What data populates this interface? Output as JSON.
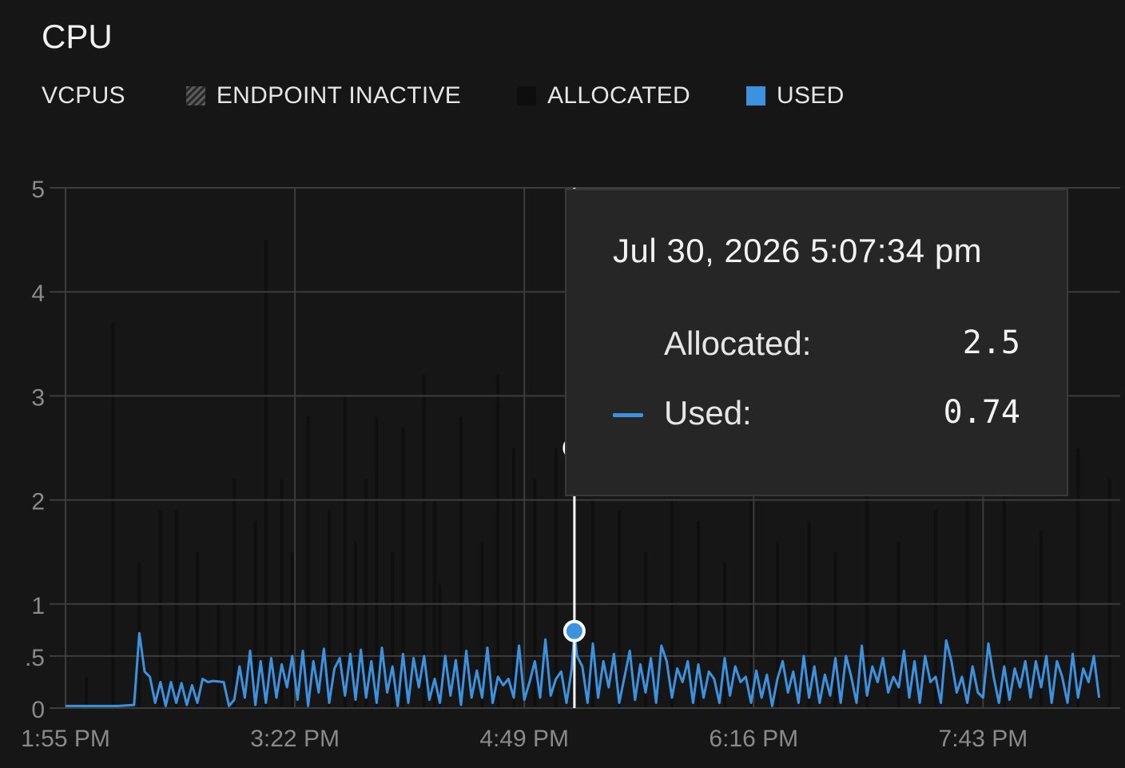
{
  "panel": {
    "title": "CPU"
  },
  "legend": {
    "unit_label": "VCPUS",
    "items": [
      {
        "label": "ENDPOINT INACTIVE",
        "icon": "hatched-square-icon",
        "color": "#5a5a5a"
      },
      {
        "label": "ALLOCATED",
        "icon": "square-icon",
        "color": "#0e0e0e"
      },
      {
        "label": "USED",
        "icon": "square-icon",
        "color": "#3d92e0"
      }
    ]
  },
  "tooltip": {
    "timestamp": "Jul 30, 2026 5:07:34 pm",
    "allocated_label": "Allocated:",
    "allocated_value": "2.5",
    "used_label": "Used:",
    "used_value": "0.74"
  },
  "chart_data": {
    "type": "line",
    "xlim_minutes": [
      0,
      400
    ],
    "x_ticks": [
      {
        "label": "1:55 PM",
        "t": 0
      },
      {
        "label": "3:22 PM",
        "t": 87
      },
      {
        "label": "4:49 PM",
        "t": 174
      },
      {
        "label": "6:16 PM",
        "t": 261
      },
      {
        "label": "7:43 PM",
        "t": 348
      }
    ],
    "y_ticks": [
      {
        "label": "0",
        "v": 0
      },
      {
        "label": ".5",
        "v": 0.5
      },
      {
        "label": "1",
        "v": 1
      },
      {
        "label": "2",
        "v": 2
      },
      {
        "label": "3",
        "v": 3
      },
      {
        "label": "4",
        "v": 4
      },
      {
        "label": "5",
        "v": 5
      }
    ],
    "ylim": [
      0,
      5
    ],
    "grid": true,
    "colors": {
      "used": "#3d92e0",
      "allocated": "#0e0e0e",
      "grid": "#3c3c3c",
      "cursor": "#ffffff"
    },
    "cursor": {
      "t": 193,
      "allocated": 2.5,
      "used": 0.74
    },
    "series": [
      {
        "name": "Used",
        "t": [
          0,
          10,
          20,
          26,
          28,
          30,
          32,
          34,
          36,
          38,
          40,
          42,
          44,
          46,
          48,
          50,
          52,
          54,
          56,
          60,
          62,
          64,
          66,
          68,
          70,
          72,
          74,
          76,
          78,
          80,
          82,
          84,
          86,
          88,
          90,
          92,
          94,
          96,
          98,
          100,
          102,
          104,
          106,
          108,
          110,
          112,
          114,
          116,
          118,
          120,
          122,
          124,
          126,
          128,
          130,
          132,
          134,
          136,
          138,
          140,
          142,
          144,
          146,
          148,
          150,
          152,
          154,
          156,
          158,
          160,
          162,
          164,
          166,
          168,
          170,
          172,
          174,
          176,
          178,
          180,
          182,
          184,
          186,
          188,
          190,
          192,
          193,
          194,
          196,
          198,
          200,
          202,
          204,
          206,
          208,
          210,
          212,
          214,
          216,
          218,
          220,
          222,
          224,
          226,
          228,
          230,
          232,
          234,
          236,
          238,
          240,
          242,
          244,
          246,
          248,
          250,
          252,
          254,
          256,
          258,
          260,
          262,
          264,
          266,
          268,
          270,
          272,
          274,
          276,
          278,
          280,
          282,
          284,
          286,
          288,
          290,
          292,
          294,
          296,
          298,
          300,
          302,
          304,
          306,
          308,
          310,
          312,
          314,
          316,
          318,
          320,
          322,
          324,
          326,
          328,
          330,
          332,
          334,
          336,
          338,
          340,
          342,
          344,
          346,
          348,
          350,
          352,
          354,
          356,
          358,
          360,
          362,
          364,
          366,
          368,
          370,
          372,
          374,
          376,
          378,
          380,
          382,
          384,
          386,
          388,
          390,
          392,
          394,
          396,
          398,
          400
        ],
        "values": [
          0.02,
          0.02,
          0.02,
          0.03,
          0.72,
          0.35,
          0.3,
          0.05,
          0.25,
          0.02,
          0.25,
          0.05,
          0.24,
          0.03,
          0.22,
          0.05,
          0.28,
          0.25,
          0.26,
          0.25,
          0.02,
          0.08,
          0.4,
          0.1,
          0.55,
          0.03,
          0.45,
          0.05,
          0.48,
          0.1,
          0.42,
          0.2,
          0.5,
          0.08,
          0.55,
          0.02,
          0.45,
          0.15,
          0.57,
          0.05,
          0.38,
          0.48,
          0.12,
          0.52,
          0.08,
          0.56,
          0.1,
          0.45,
          0.05,
          0.58,
          0.15,
          0.4,
          0.02,
          0.52,
          0.05,
          0.48,
          0.2,
          0.5,
          0.08,
          0.28,
          0.05,
          0.5,
          0.12,
          0.46,
          0.03,
          0.55,
          0.1,
          0.36,
          0.1,
          0.58,
          0.05,
          0.3,
          0.22,
          0.28,
          0.1,
          0.6,
          0.08,
          0.25,
          0.45,
          0.1,
          0.66,
          0.12,
          0.28,
          0.35,
          0.05,
          0.38,
          0.74,
          0.5,
          0.4,
          0.05,
          0.62,
          0.1,
          0.45,
          0.2,
          0.52,
          0.05,
          0.3,
          0.55,
          0.08,
          0.42,
          0.15,
          0.48,
          0.05,
          0.6,
          0.45,
          0.1,
          0.38,
          0.25,
          0.45,
          0.05,
          0.42,
          0.1,
          0.35,
          0.28,
          0.05,
          0.48,
          0.12,
          0.4,
          0.25,
          0.3,
          0.05,
          0.36,
          0.1,
          0.32,
          0.02,
          0.28,
          0.45,
          0.15,
          0.35,
          0.05,
          0.5,
          0.1,
          0.4,
          0.05,
          0.32,
          0.12,
          0.48,
          0.05,
          0.5,
          0.3,
          0.05,
          0.6,
          0.12,
          0.4,
          0.25,
          0.48,
          0.15,
          0.3,
          0.2,
          0.55,
          0.1,
          0.45,
          0.05,
          0.5,
          0.25,
          0.3,
          0.05,
          0.65,
          0.45,
          0.15,
          0.3,
          0.05,
          0.4,
          0.15,
          0.1,
          0.62,
          0.3,
          0.05,
          0.4,
          0.08,
          0.38,
          0.2,
          0.45,
          0.1,
          0.45,
          0.2,
          0.5,
          0.05,
          0.45,
          0.3,
          0.05,
          0.52,
          0.1,
          0.38,
          0.25,
          0.5,
          0.1
        ]
      },
      {
        "name": "Allocated",
        "t": [
          8,
          18,
          28,
          36,
          42,
          50,
          58,
          64,
          72,
          76,
          82,
          86,
          92,
          100,
          106,
          110,
          114,
          118,
          124,
          128,
          136,
          140,
          142,
          150,
          158,
          164,
          170,
          178,
          186,
          200,
          210,
          220,
          230,
          240,
          250,
          260,
          270,
          282,
          292,
          304,
          316,
          330,
          342,
          356,
          370,
          384,
          396
        ],
        "values": [
          0.3,
          3.7,
          1.4,
          1.9,
          1.9,
          1.5,
          1.0,
          2.2,
          1.8,
          4.5,
          2.2,
          1.5,
          2.8,
          1.9,
          3.0,
          1.6,
          2.2,
          2.8,
          1.5,
          2.7,
          3.2,
          2.0,
          1.2,
          2.8,
          1.6,
          3.2,
          2.5,
          2.2,
          2.5,
          2.0,
          1.9,
          1.5,
          2.0,
          1.8,
          1.4,
          2.0,
          1.6,
          1.8,
          1.5,
          2.2,
          1.6,
          1.9,
          2.0,
          2.7,
          1.7,
          2.5,
          2.2
        ]
      }
    ]
  }
}
